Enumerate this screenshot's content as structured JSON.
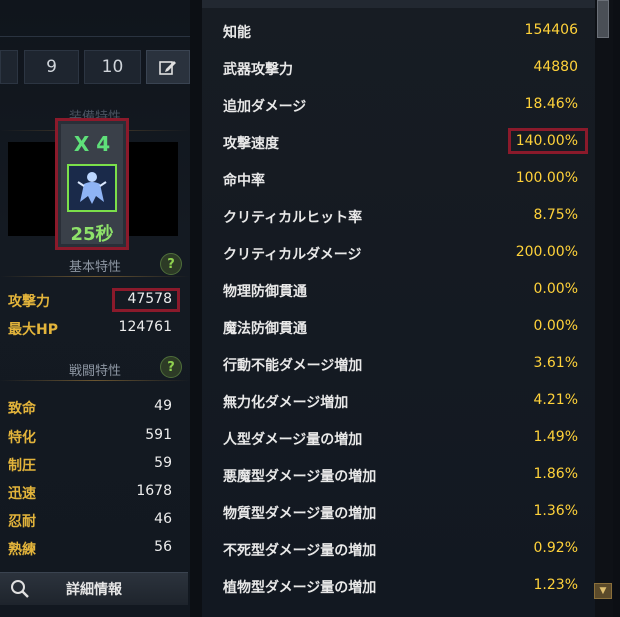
{
  "tabs": {
    "partial": "",
    "tab9": "9",
    "tab10": "10"
  },
  "left": {
    "equip_title": "装備特性",
    "buff": {
      "stack": "X 4",
      "timer": "25秒"
    },
    "basic_title": "基本特性",
    "basic": [
      {
        "label": "攻撃力",
        "value": "47578"
      },
      {
        "label": "最大HP",
        "value": "124761"
      }
    ],
    "combat_title": "戦闘特性",
    "combat": [
      {
        "label": "致命",
        "value": "49"
      },
      {
        "label": "特化",
        "value": "591"
      },
      {
        "label": "制圧",
        "value": "59"
      },
      {
        "label": "迅速",
        "value": "1678"
      },
      {
        "label": "忍耐",
        "value": "46"
      },
      {
        "label": "熟練",
        "value": "56"
      }
    ],
    "detail_button": "詳細情報"
  },
  "right": {
    "stats": [
      {
        "name": "知能",
        "value": "154406"
      },
      {
        "name": "武器攻撃力",
        "value": "44880"
      },
      {
        "name": "追加ダメージ",
        "value": "18.46%"
      },
      {
        "name": "攻撃速度",
        "value": "140.00%"
      },
      {
        "name": "命中率",
        "value": "100.00%"
      },
      {
        "name": "クリティカルヒット率",
        "value": "8.75%"
      },
      {
        "name": "クリティカルダメージ",
        "value": "200.00%"
      },
      {
        "name": "物理防御貫通",
        "value": "0.00%"
      },
      {
        "name": "魔法防御貫通",
        "value": "0.00%"
      },
      {
        "name": "行動不能ダメージ増加",
        "value": "3.61%"
      },
      {
        "name": "無力化ダメージ増加",
        "value": "4.21%"
      },
      {
        "name": "人型ダメージ量の増加",
        "value": "1.49%"
      },
      {
        "name": "悪魔型ダメージ量の増加",
        "value": "1.86%"
      },
      {
        "name": "物質型ダメージ量の増加",
        "value": "1.36%"
      },
      {
        "name": "不死型ダメージ量の増加",
        "value": "0.92%"
      },
      {
        "name": "植物型ダメージ量の増加",
        "value": "1.23%"
      }
    ]
  },
  "colors": {
    "label_gold": "#e3b43b",
    "value_yellow": "#ffd23a",
    "highlight": "#8b1a2b",
    "buff_green": "#5fe07a"
  }
}
